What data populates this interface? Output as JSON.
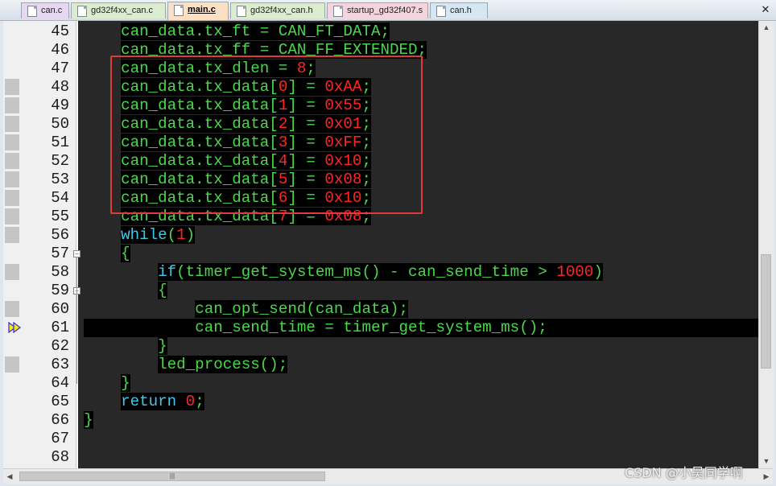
{
  "tabs": [
    {
      "label": "can.c",
      "color": "#e7d7f0",
      "active": false
    },
    {
      "label": "gd32f4xx_can.c",
      "color": "#dbeccf",
      "active": false
    },
    {
      "label": "main.c",
      "color": "#fbe0c4",
      "active": true
    },
    {
      "label": "gd32f4xx_can.h",
      "color": "#dbeccf",
      "active": false
    },
    {
      "label": "startup_gd32f407.s",
      "color": "#f5d5dd",
      "active": false
    },
    {
      "label": "can.h",
      "color": "#d5e7f2",
      "active": false
    }
  ],
  "close_label": "✕",
  "lines": [
    {
      "num": "45",
      "indent": "    ",
      "tokens": [
        [
          "g",
          "can_data.tx_ft = CAN_FT_DATA;"
        ]
      ]
    },
    {
      "num": "46",
      "indent": "    ",
      "tokens": [
        [
          "g",
          "can_data.tx_ff = CAN_FF_EXTENDED;"
        ]
      ]
    },
    {
      "num": "47",
      "indent": "    ",
      "tokens": [
        [
          "g",
          "can_data.tx_dlen = "
        ],
        [
          "r",
          "8"
        ],
        [
          "g",
          ";"
        ]
      ]
    },
    {
      "num": "48",
      "indent": "    ",
      "tokens": [
        [
          "g",
          "can_data.tx_data["
        ],
        [
          "r",
          "0"
        ],
        [
          "g",
          "] = "
        ],
        [
          "r",
          "0xAA"
        ],
        [
          "g",
          ";"
        ]
      ]
    },
    {
      "num": "49",
      "indent": "    ",
      "tokens": [
        [
          "g",
          "can_data.tx_data["
        ],
        [
          "r",
          "1"
        ],
        [
          "g",
          "] = "
        ],
        [
          "r",
          "0x55"
        ],
        [
          "g",
          ";"
        ]
      ]
    },
    {
      "num": "50",
      "indent": "    ",
      "tokens": [
        [
          "g",
          "can_data.tx_data["
        ],
        [
          "r",
          "2"
        ],
        [
          "g",
          "] = "
        ],
        [
          "r",
          "0x01"
        ],
        [
          "g",
          ";"
        ]
      ]
    },
    {
      "num": "51",
      "indent": "    ",
      "tokens": [
        [
          "g",
          "can_data.tx_data["
        ],
        [
          "r",
          "3"
        ],
        [
          "g",
          "] = "
        ],
        [
          "r",
          "0xFF"
        ],
        [
          "g",
          ";"
        ]
      ]
    },
    {
      "num": "52",
      "indent": "    ",
      "tokens": [
        [
          "g",
          "can_data.tx_data["
        ],
        [
          "r",
          "4"
        ],
        [
          "g",
          "] = "
        ],
        [
          "r",
          "0x10"
        ],
        [
          "g",
          ";"
        ]
      ]
    },
    {
      "num": "53",
      "indent": "    ",
      "tokens": [
        [
          "g",
          "can_data.tx_data["
        ],
        [
          "r",
          "5"
        ],
        [
          "g",
          "] = "
        ],
        [
          "r",
          "0x08"
        ],
        [
          "g",
          ";"
        ]
      ]
    },
    {
      "num": "54",
      "indent": "    ",
      "tokens": [
        [
          "g",
          "can_data.tx_data["
        ],
        [
          "r",
          "6"
        ],
        [
          "g",
          "] = "
        ],
        [
          "r",
          "0x10"
        ],
        [
          "g",
          ";"
        ]
      ]
    },
    {
      "num": "55",
      "indent": "    ",
      "tokens": [
        [
          "g",
          "can_data.tx_data["
        ],
        [
          "r",
          "7"
        ],
        [
          "g",
          "] = "
        ],
        [
          "r",
          "0x08"
        ],
        [
          "g",
          ";"
        ]
      ]
    },
    {
      "num": "56",
      "indent": "    ",
      "tokens": [
        [
          "c",
          "while"
        ],
        [
          "g",
          "("
        ],
        [
          "r",
          "1"
        ],
        [
          "g",
          ")"
        ]
      ]
    },
    {
      "num": "57",
      "indent": "    ",
      "tokens": [
        [
          "g",
          "{"
        ]
      ]
    },
    {
      "num": "58",
      "indent": "        ",
      "tokens": [
        [
          "c",
          "if"
        ],
        [
          "g",
          "(timer_get_system_ms() - can_send_time > "
        ],
        [
          "r",
          "1000"
        ],
        [
          "g",
          ")"
        ]
      ]
    },
    {
      "num": "59",
      "indent": "        ",
      "tokens": [
        [
          "g",
          "{"
        ]
      ]
    },
    {
      "num": "60",
      "indent": "            ",
      "tokens": [
        [
          "g",
          "can_opt_send(can_data);"
        ]
      ]
    },
    {
      "num": "61",
      "indent": "            ",
      "tokens": [
        [
          "g",
          "can_send_time = timer_get_system_ms();"
        ]
      ]
    },
    {
      "num": "62",
      "indent": "        ",
      "tokens": [
        [
          "g",
          "}"
        ]
      ]
    },
    {
      "num": "63",
      "indent": "        ",
      "tokens": [
        [
          "g",
          "led_process();"
        ]
      ]
    },
    {
      "num": "64",
      "indent": "    ",
      "tokens": [
        [
          "g",
          "}"
        ]
      ]
    },
    {
      "num": "65",
      "indent": "    ",
      "tokens": [
        [
          "c",
          "return"
        ],
        [
          "g",
          " "
        ],
        [
          "r",
          "0"
        ],
        [
          "g",
          ";"
        ]
      ]
    },
    {
      "num": "66",
      "indent": "",
      "tokens": [
        [
          "g",
          "}"
        ]
      ]
    },
    {
      "num": "67",
      "indent": "",
      "tokens": []
    },
    {
      "num": "68",
      "indent": "",
      "tokens": []
    }
  ],
  "current_line": "61",
  "marked_lines": [
    "48",
    "49",
    "50",
    "51",
    "52",
    "53",
    "54",
    "55",
    "56",
    "58",
    "60",
    "61",
    "63"
  ],
  "fold_lines": [
    "57",
    "59"
  ],
  "scroll_grip": "|||",
  "watermark": "CSDN @小吴同学啊",
  "colors": {
    "keyword": "#3fc8e8",
    "identifier": "#4ad84a",
    "literal": "#ff2525",
    "highlight_box": "#e23a3a"
  }
}
